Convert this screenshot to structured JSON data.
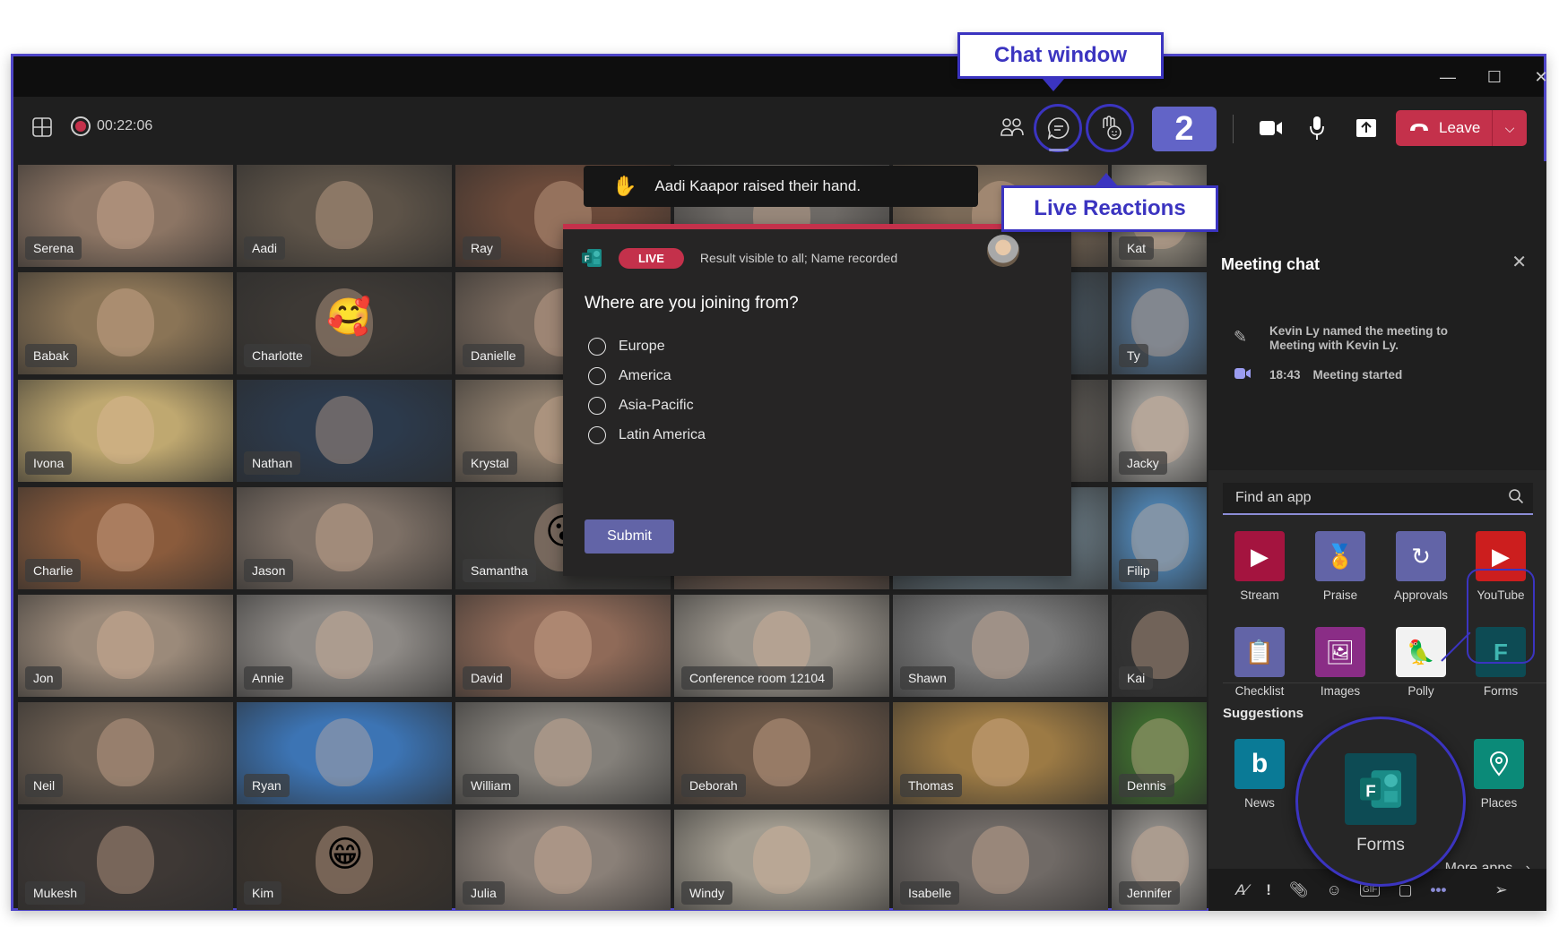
{
  "window": {
    "controls": {
      "minimize": "—",
      "maximize": "☐",
      "close": "✕"
    }
  },
  "toolbar": {
    "timer": "00:22:06",
    "raised_count": "2",
    "leave_label": "Leave",
    "icons": [
      "grid-layout-icon",
      "recording-icon",
      "people-icon",
      "chat-icon",
      "reactions-icon",
      "camera-icon",
      "microphone-icon",
      "share-icon",
      "phone-hangup-icon",
      "chevron-down-icon"
    ]
  },
  "callouts": {
    "chat_window": "Chat window",
    "live_reactions": "Live Reactions"
  },
  "banner": {
    "text": "Aadi Kaapor raised their hand.",
    "icon": "✋"
  },
  "poll": {
    "status": "LIVE",
    "meta": "Result visible to all; Name recorded",
    "question": "Where are you joining from?",
    "options": [
      "Europe",
      "America",
      "Asia-Pacific",
      "Latin America"
    ],
    "submit_label": "Submit"
  },
  "participants": [
    {
      "name": "Serena",
      "color": "#8c7564"
    },
    {
      "name": "Aadi",
      "color": "#5d5348"
    },
    {
      "name": "Ray",
      "color": "#6b4a3a"
    },
    {
      "name": "",
      "color": "#6e6a66"
    },
    {
      "name": "",
      "color": "#7b6a58"
    },
    {
      "name": "Kat",
      "color": "#8b8478"
    },
    {
      "name": "Babak",
      "color": "#8a7456"
    },
    {
      "name": "Charlotte",
      "color": "#3d3935",
      "reaction": "🥰"
    },
    {
      "name": "Danielle",
      "color": "#77685c"
    },
    {
      "name": "",
      "color": "#505a60"
    },
    {
      "name": "",
      "color": "#45525c"
    },
    {
      "name": "Ty",
      "color": "#4d6a86"
    },
    {
      "name": "Ivona",
      "color": "#bfa870"
    },
    {
      "name": "Nathan",
      "color": "#2c3a4c"
    },
    {
      "name": "Krystal",
      "color": "#8d7d6c"
    },
    {
      "name": "",
      "color": "#6f7276"
    },
    {
      "name": "",
      "color": "#5e5a55"
    },
    {
      "name": "Jacky",
      "color": "#9c9a96"
    },
    {
      "name": "Charlie",
      "color": "#8a5b3c"
    },
    {
      "name": "Jason",
      "color": "#7d7066"
    },
    {
      "name": "Samantha",
      "color": "#3c3b39",
      "reaction": "😮"
    },
    {
      "name": "",
      "color": "#826a5c"
    },
    {
      "name": "",
      "color": "#6b7c86"
    },
    {
      "name": "Filip",
      "color": "#4d7fab"
    },
    {
      "name": "Jon",
      "color": "#9b8a7a"
    },
    {
      "name": "Annie",
      "color": "#8e8a86"
    },
    {
      "name": "David",
      "color": "#8f6a58"
    },
    {
      "name": "Conference room 12104",
      "color": "#9a948b"
    },
    {
      "name": "Shawn",
      "color": "#7a7a7a"
    },
    {
      "name": "Kai",
      "color": "#343434"
    },
    {
      "name": "Neil",
      "color": "#6d5f52"
    },
    {
      "name": "Ryan",
      "color": "#3c74b4"
    },
    {
      "name": "William",
      "color": "#84807a"
    },
    {
      "name": "Deborah",
      "color": "#6d5848"
    },
    {
      "name": "Thomas",
      "color": "#9c7a44"
    },
    {
      "name": "Dennis",
      "color": "#3d6a2e"
    },
    {
      "name": "Mukesh",
      "color": "#3e3835"
    },
    {
      "name": "Kim",
      "color": "#3d352e",
      "reaction": "😁"
    },
    {
      "name": "Julia",
      "color": "#8a8078"
    },
    {
      "name": "Windy",
      "color": "#a29c90"
    },
    {
      "name": "Isabelle",
      "color": "#706a66"
    },
    {
      "name": "Jennifer",
      "color": "#8d8a86"
    }
  ],
  "chat": {
    "title": "Meeting chat",
    "messages": [
      {
        "icon": "pencil-icon",
        "text_line1": "Kevin Ly named the meeting to",
        "text_line2": "Meeting with Kevin Ly."
      },
      {
        "icon": "meeting-camera-icon",
        "time": "18:43",
        "text": "Meeting started"
      }
    ],
    "find_app_placeholder": "Find an app",
    "apps": [
      {
        "label": "Stream",
        "color": "#a4143f",
        "glyph": "▶"
      },
      {
        "label": "Praise",
        "color": "#6264a7",
        "glyph": "🏅"
      },
      {
        "label": "Approvals",
        "color": "#6264a7",
        "glyph": "↻"
      },
      {
        "label": "YouTube",
        "color": "#cc1e1e",
        "glyph": "▶"
      },
      {
        "label": "Checklist",
        "color": "#6264a7",
        "glyph": "📋"
      },
      {
        "label": "Images",
        "color": "#8a2d86",
        "glyph": "🖼"
      },
      {
        "label": "Polly",
        "color": "#f2f2f2",
        "glyph": "🦜"
      },
      {
        "label": "Forms",
        "color": "#0d4b54",
        "glyph": "F"
      }
    ],
    "suggestions_label": "Suggestions",
    "suggestions": [
      {
        "label": "News",
        "color": "#0a7a96",
        "glyph": "b"
      },
      {
        "label": "Forms",
        "color": "#0d4b54",
        "glyph": "F"
      },
      {
        "label": "Places",
        "color": "#0b8a78",
        "glyph": "⌖"
      }
    ],
    "more_apps_label": "More apps",
    "compose_icons": [
      "format-icon",
      "important-icon",
      "attach-icon",
      "emoji-icon",
      "gif-icon",
      "sticker-icon",
      "more-options-icon",
      "send-icon"
    ]
  }
}
